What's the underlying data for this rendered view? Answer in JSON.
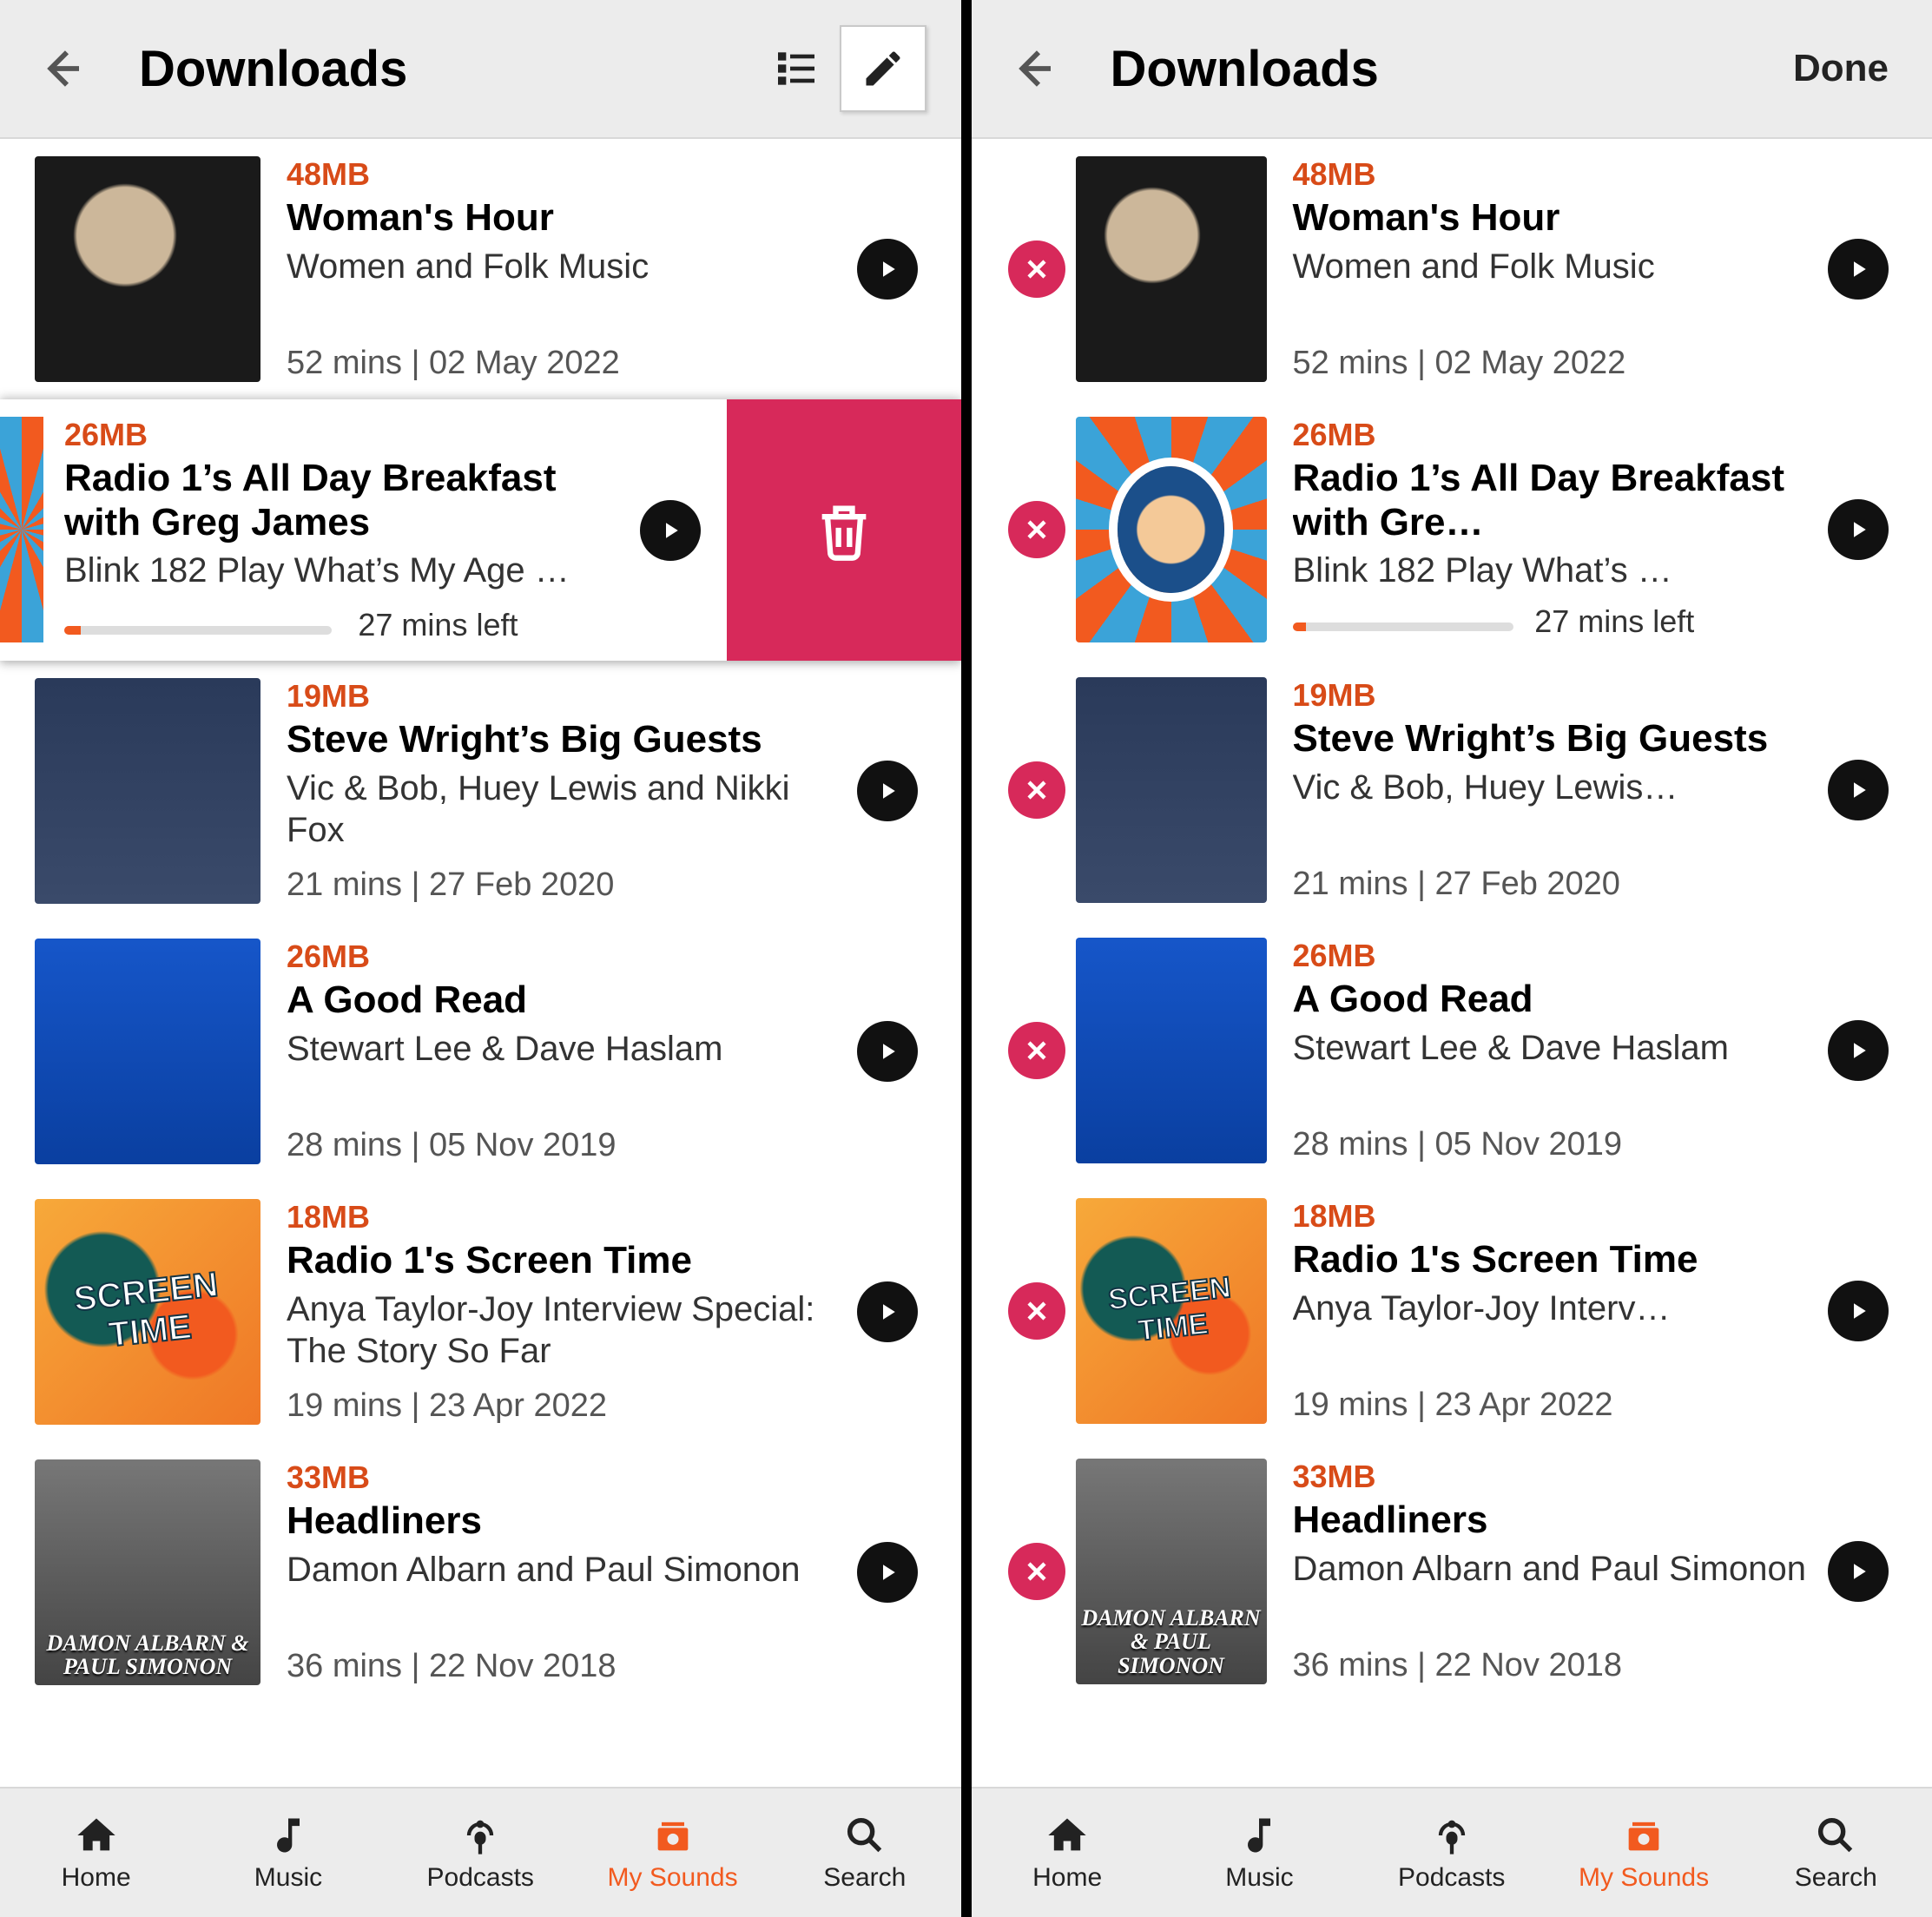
{
  "header": {
    "title": "Downloads",
    "done_label": "Done"
  },
  "tabs": {
    "home": "Home",
    "music": "Music",
    "podcasts": "Podcasts",
    "mysounds": "My Sounds",
    "search": "Search"
  },
  "items": [
    {
      "size": "48MB",
      "title": "Woman's Hour",
      "subtitle": "Women and Folk Music",
      "meta": "52 mins | 02 May 2022"
    },
    {
      "size": "26MB",
      "title": "Radio 1’s All Day Breakfast with Greg James",
      "title_edit": "Radio 1’s All Day Breakfast with Gre…",
      "subtitle_swiped": "Blink 182 Play What’s My Age …",
      "subtitle_edit": "Blink 182 Play What’s …",
      "timeleft": "27 mins left"
    },
    {
      "size": "19MB",
      "title": "Steve Wright’s Big Guests",
      "subtitle": "Vic & Bob, Huey Lewis and Nikki Fox",
      "subtitle_edit": "Vic & Bob, Huey Lewis…",
      "meta": "21 mins | 27 Feb 2020"
    },
    {
      "size": "26MB",
      "title": "A Good Read",
      "subtitle": "Stewart Lee & Dave Haslam",
      "meta": "28 mins | 05 Nov 2019"
    },
    {
      "size": "18MB",
      "title": "Radio 1's Screen Time",
      "subtitle": "Anya Taylor-Joy Interview Special: The Story So Far",
      "subtitle_edit": "Anya Taylor-Joy Interv…",
      "meta": "19 mins | 23 Apr 2022"
    },
    {
      "size": "33MB",
      "title": "Headliners",
      "subtitle": "Damon Albarn and Paul Simonon",
      "meta": "36 mins | 22 Nov 2018",
      "overlay": "DAMON ALBARN & PAUL SIMONON"
    }
  ]
}
